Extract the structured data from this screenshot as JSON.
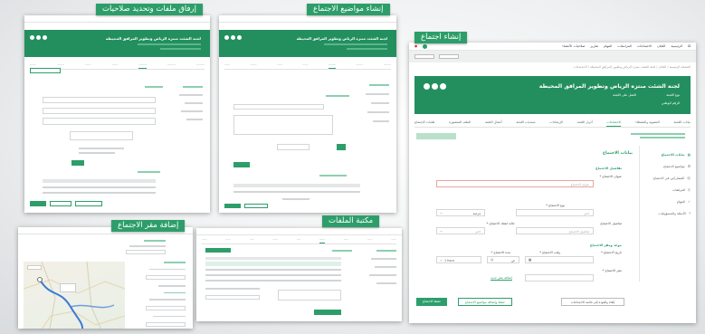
{
  "labels": {
    "attach_files": "إرفاق ملفات وتحديد صلاحيات",
    "create_topics": "إنشاء مواضيع الاجتماع",
    "create_meeting": "إنشاء اجتماع",
    "add_venue": "إضافة مقر الاجتماع",
    "library": "مكتبة الملفات"
  },
  "main": {
    "nav": [
      "الرئيسية",
      "اللجان",
      "الاجتماعات",
      "المراسلات",
      "المهام",
      "تقارير",
      "صلاحيات الأعضاء"
    ],
    "committee_title": "لجنة الشئت منتزه الرياض وتطوير المرافق المحيطة",
    "meta": [
      "نوع اللجنة",
      "العمل على اللجنة",
      "الرقم الوطني"
    ],
    "breadcrumb": "الصفحة الرئيسية / اللجان / لجنة الشئت منتزه الرياض وتطوير المرافق المحيطة / الاجتماعات",
    "tabs": [
      "بيانات اللجنة",
      "العضوية والنشطاء",
      "الاجتماعات",
      "أدوار اللجنة",
      "الإرشادات",
      "مبتديات اللجنة",
      "أعمال اللجنة",
      "الملف المنشورة",
      "طلبات الإجتماع"
    ],
    "active_tab": "الاجتماعات",
    "sidebar": [
      "بيانات الاجتماع",
      "مواضيع الاجتماع",
      "المشاركين في الاجتماع",
      "المرفقات",
      "المهام",
      "الأسئلة والمسؤوليات"
    ],
    "section_title": "بيانات الاجتماع",
    "sub1": "تفاصيل الاجتماع",
    "fields": {
      "title_label": "عنوان الاجتماع *",
      "title_ph": "عنوان الاجتماع",
      "type_label": "نوع الاجتماع *",
      "type_val": "اختر",
      "sub_val": "فرعية",
      "desc_label": "تفاصيل الاجتماع",
      "desc_ph": "تفاصيل الاجتماع",
      "frequency_label": "حالة انعقاد الاجتماع *",
      "frequency_val": "اختر"
    },
    "sub2": "موعد ومقر الاجتماع",
    "time_fields": {
      "date_label": "تاريخ الاجتماع *",
      "from_label": "وقت الاجتماع *",
      "to_label": "مدة الاجتماع *",
      "am": "ص",
      "hours": "1 hour",
      "add_link": "إضافة مقر جديد",
      "venue_label": "مقر الاجتماع *"
    },
    "buttons": {
      "save": "حفظ الاجتماع",
      "save_topics": "حفظ وإضافة مواضيع الاجتماع",
      "cancel": "إلغاء والعودة إلى قائمة الاجتماعات"
    }
  }
}
